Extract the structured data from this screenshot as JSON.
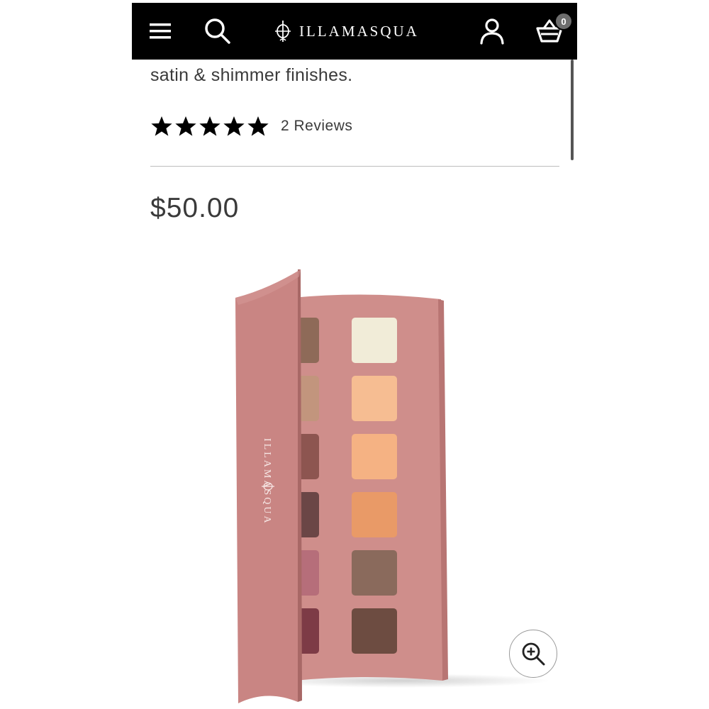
{
  "header": {
    "brand": "ILLAMASQUA",
    "basket_count": "0",
    "background": "#000000"
  },
  "product": {
    "description_tail": "satin & shimmer finishes.",
    "rating_stars": 5,
    "reviews_label": "2 Reviews",
    "price": "$50.00",
    "palette_brand": "ILLAMASQUA",
    "palette_case_color": "#c98a88",
    "swatches_left": [
      "#8e6a58",
      "#c2957d",
      "#8d5550",
      "#6b4646",
      "#b66e7a",
      "#7d3b46"
    ],
    "swatches_right": [
      "#f1ecd8",
      "#f6bd92",
      "#f5b283",
      "#e99a67",
      "#8a6a5c",
      "#6d4c41"
    ]
  },
  "icons": {
    "menu": "menu-icon",
    "search": "search-icon",
    "logo_mark": "logo-icon",
    "account": "account-icon",
    "basket": "basket-icon",
    "zoom": "zoom-in-icon",
    "star": "star-icon"
  }
}
